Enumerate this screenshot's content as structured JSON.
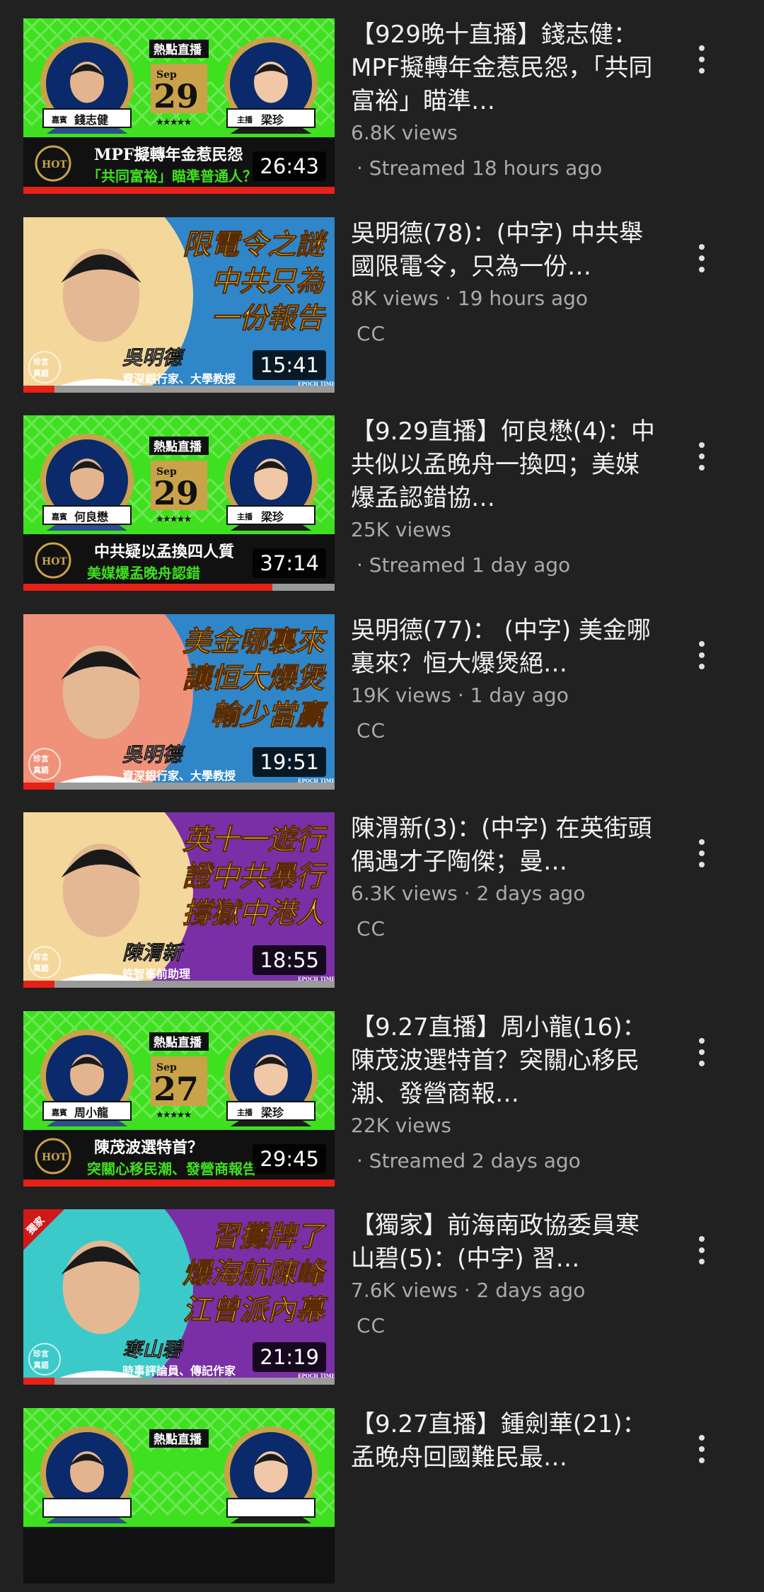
{
  "videos": [
    {
      "title": "【929晚十直播】錢志健：MPF擬轉年金惹民怨，「共同富裕」瞄準…",
      "views": "6.8K views",
      "time": "· Streamed 18 hours ago",
      "duration": "26:43",
      "progress": 1.0,
      "thumb": {
        "kind": "live",
        "badge": "熱點直播",
        "month": "Sep",
        "day": "29",
        "guest_tag": "嘉賓",
        "guest": "錢志健",
        "host_tag": "主播",
        "host": "梁珍",
        "hot": "HOT",
        "line1": "MPF擬轉年金惹民怨",
        "line2": "「共同富裕」瞄準普通人？"
      }
    },
    {
      "title": "吳明德(78)：(中字) 中共舉國限電令，只為一份…",
      "meta": "8K views · 19 hours ago",
      "cc": "CC",
      "duration": "15:41",
      "progress": 0.1,
      "thumb": {
        "kind": "talk",
        "bg": "#2f86c8",
        "circle": "#f4d79a",
        "lines": [
          "限電令之謎",
          "中共只為",
          "一份報告"
        ],
        "name": "吳明德",
        "role": "資深銀行家、大學教授",
        "logo": "珍言真語",
        "brand": "EPOCH TIMES"
      }
    },
    {
      "title": "【9.29直播】何良懋(4)：中共似以孟晚舟一換四；美媒爆孟認錯協…",
      "views": "25K views",
      "time": "· Streamed 1 day ago",
      "duration": "37:14",
      "progress": 0.8,
      "thumb": {
        "kind": "live",
        "badge": "熱點直播",
        "month": "Sep",
        "day": "29",
        "guest_tag": "嘉賓",
        "guest": "何良懋",
        "host_tag": "主播",
        "host": "梁珍",
        "hot": "HOT",
        "line1": "中共疑以孟換四人質",
        "line2": "美媒爆孟晚舟認錯"
      }
    },
    {
      "title": "吳明德(77)： (中字) 美金哪裏來？恒大爆煲絕…",
      "meta": "19K views · 1 day ago",
      "cc": "CC",
      "duration": "19:51",
      "progress": 0.1,
      "thumb": {
        "kind": "talk",
        "bg": "#2f86c8",
        "circle": "#f0917a",
        "lines": [
          "美金哪裏來",
          "讓恒大爆煲",
          "輸少當贏"
        ],
        "name": "吳明德",
        "role": "資深銀行家、大學教授",
        "logo": "珍言真語",
        "brand": "EPOCH TIMES"
      }
    },
    {
      "title": "陳渭新(3)：(中字) 在英街頭偶遇才子陶傑；曼…",
      "meta": "6.3K views · 2 days ago",
      "cc": "CC",
      "duration": "18:55",
      "progress": 0.1,
      "thumb": {
        "kind": "talk",
        "bg": "#7a2fa6",
        "circle": "#f4d79a",
        "lines": [
          "英十一遊行",
          "證中共暴行",
          "撐獄中港人"
        ],
        "name": "陳渭新",
        "role": "許智峯前助理",
        "logo": "珍言真語",
        "brand": "EPOCH TIMES"
      }
    },
    {
      "title": "【9.27直播】周小龍(16)：陳茂波選特首？突關心移民潮、發營商報…",
      "views": "22K views",
      "time": "· Streamed 2 days ago",
      "duration": "29:45",
      "progress": 1.0,
      "thumb": {
        "kind": "live",
        "badge": "熱點直播",
        "month": "Sep",
        "day": "27",
        "guest_tag": "嘉賓",
        "guest": "周小龍",
        "host_tag": "主播",
        "host": "梁珍",
        "hot": "HOT",
        "line1": "陳茂波選特首？",
        "line2": "突關心移民潮、發營商報告"
      }
    },
    {
      "title": "【獨家】前海南政協委員寒山碧(5)：(中字) 習…",
      "meta": "7.6K views · 2 days ago",
      "cc": "CC",
      "duration": "21:19",
      "progress": 0.1,
      "thumb": {
        "kind": "talk",
        "bg": "#7a2fa6",
        "circle": "#3cc9c9",
        "corner": "獨家",
        "lines": [
          "習攤牌了",
          "爆海航陳峰",
          "江曾派內幕"
        ],
        "name": "寒山碧",
        "role": "時事評論員、傳記作家",
        "logo": "珍言真語",
        "brand": "EPOCH TIMES"
      }
    },
    {
      "title": "【9.27直播】鍾劍華(21)：孟晚舟回國難民最…",
      "views": "",
      "time": "",
      "duration": "",
      "progress": 0,
      "thumb": {
        "kind": "live",
        "badge": "熱點直播",
        "month": "",
        "day": "",
        "guest_tag": "",
        "guest": "",
        "host_tag": "",
        "host": "",
        "hot": "",
        "line1": "",
        "line2": ""
      }
    }
  ],
  "colors": {
    "background": "#212121",
    "live_green": "#3fe01f",
    "progress_red": "#e62117",
    "meta_gray": "#aaaaaa"
  },
  "icons": {
    "more": "more-vert-icon"
  }
}
